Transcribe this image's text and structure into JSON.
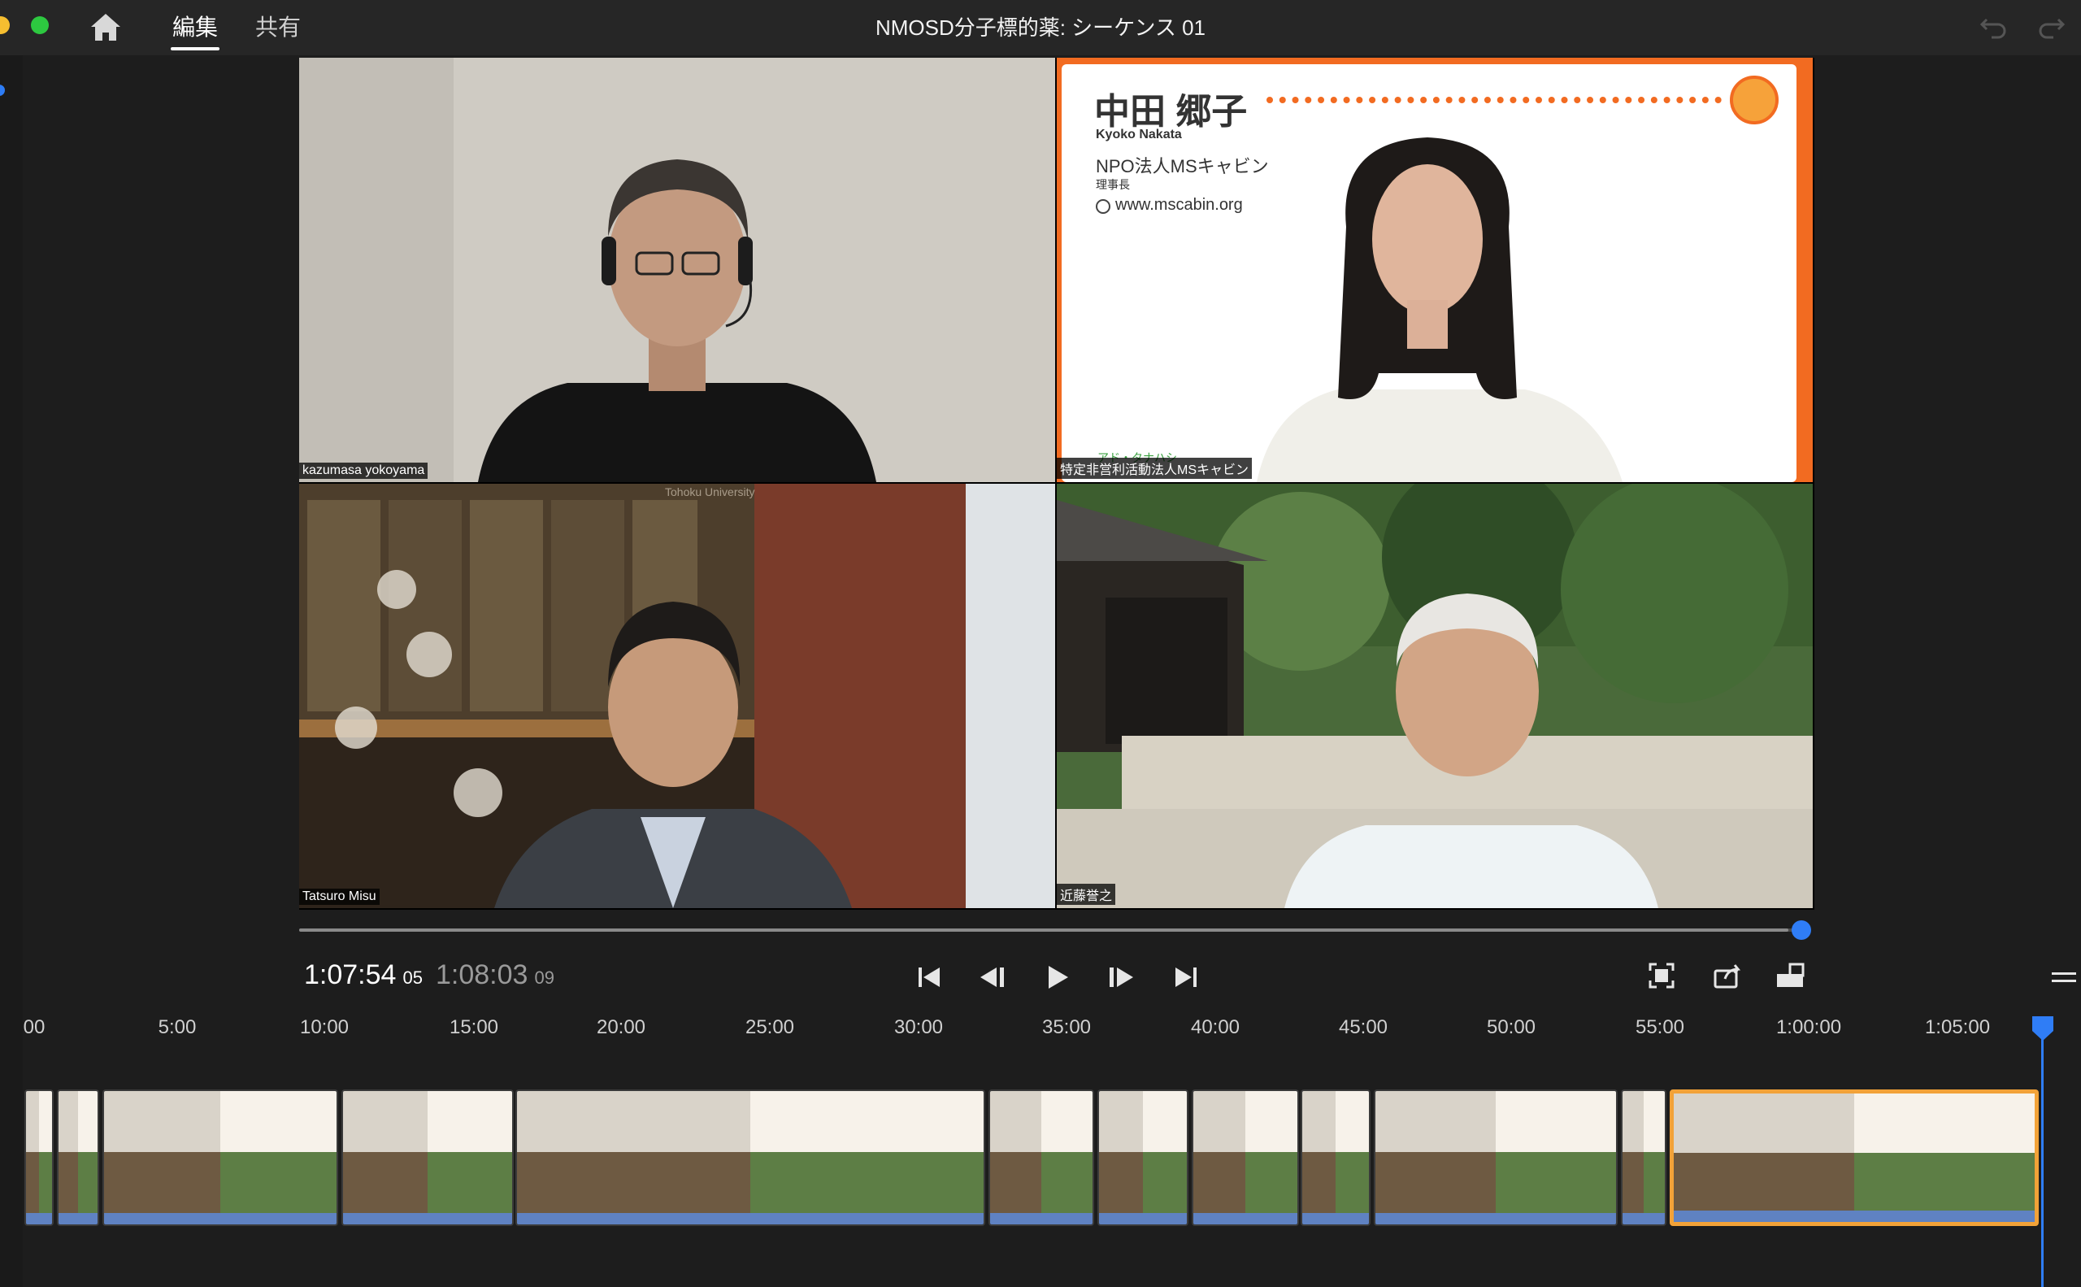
{
  "window": {
    "title": "NMOSD分子標的薬: シーケンス 01",
    "tabs": [
      {
        "label": "編集",
        "active": true
      },
      {
        "label": "共有",
        "active": false
      }
    ],
    "icons": [
      "home-icon",
      "undo-icon",
      "redo-icon"
    ]
  },
  "viewer": {
    "participants": [
      {
        "name_label": "kazumasa yokoyama"
      },
      {
        "name_label": "特定非営利活動法人MSキャビン",
        "card": {
          "name": "中田 郷子",
          "romaji": "Kyoko Nakata",
          "org": "NPO法人MSキャビン",
          "role": "理事長",
          "website": "www.mscabin.org",
          "footer": "アド・タナハシ"
        }
      },
      {
        "name_label": "Tatsuro Misu",
        "background_text": "Tohoku University"
      },
      {
        "name_label": "近藤誉之"
      }
    ]
  },
  "playback": {
    "current": "1:07:54",
    "current_frames": "05",
    "total": "1:08:03",
    "total_frames": "09",
    "progress": 0.99,
    "controls": [
      "go-to-start-icon",
      "step-back-icon",
      "play-icon",
      "step-forward-icon",
      "go-to-end-icon"
    ],
    "right_controls": [
      "fit-icon",
      "export-icon",
      "ratio-icon",
      "menu-icon"
    ]
  },
  "timeline": {
    "ticks": [
      "00",
      "5:00",
      "10:00",
      "15:00",
      "20:00",
      "25:00",
      "30:00",
      "35:00",
      "40:00",
      "45:00",
      "50:00",
      "55:00",
      "1:00:00",
      "1:05:00"
    ]
  },
  "colors": {
    "accent": "#2f7df6",
    "selection": "#f2a238",
    "card_border": "#f26b21",
    "background": "#1d1d1d"
  }
}
